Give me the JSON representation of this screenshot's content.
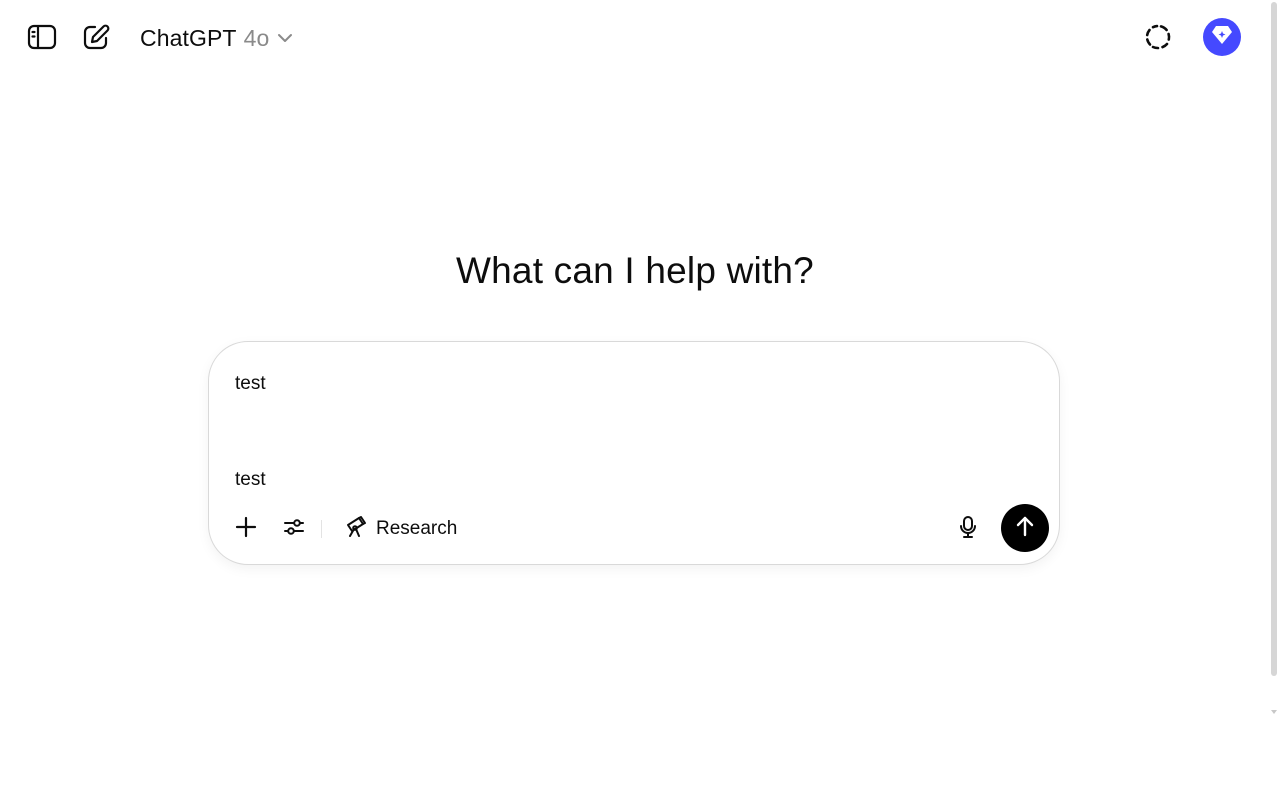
{
  "header": {
    "model_name": "ChatGPT",
    "model_version": "4o",
    "icons": {
      "sidebar_toggle": "sidebar-toggle-icon",
      "new_chat": "edit-pencil-icon",
      "model_dropdown": "chevron-down-icon",
      "temporary_chat": "dashed-circle-icon",
      "upgrade": "diamond-sparkle-icon"
    }
  },
  "main": {
    "heading": "What can I help with?"
  },
  "composer": {
    "lines": [
      "test",
      "",
      "test"
    ],
    "research_label": "Research",
    "icons": {
      "attach": "plus-icon",
      "tools": "sliders-icon",
      "research": "telescope-icon",
      "voice": "microphone-icon",
      "send": "arrow-up-icon"
    }
  },
  "colors": {
    "upgrade_badge": "#4549ff",
    "send_button": "#000000",
    "model_version": "#8a8a8a",
    "composer_border": "#d9d9d9"
  }
}
